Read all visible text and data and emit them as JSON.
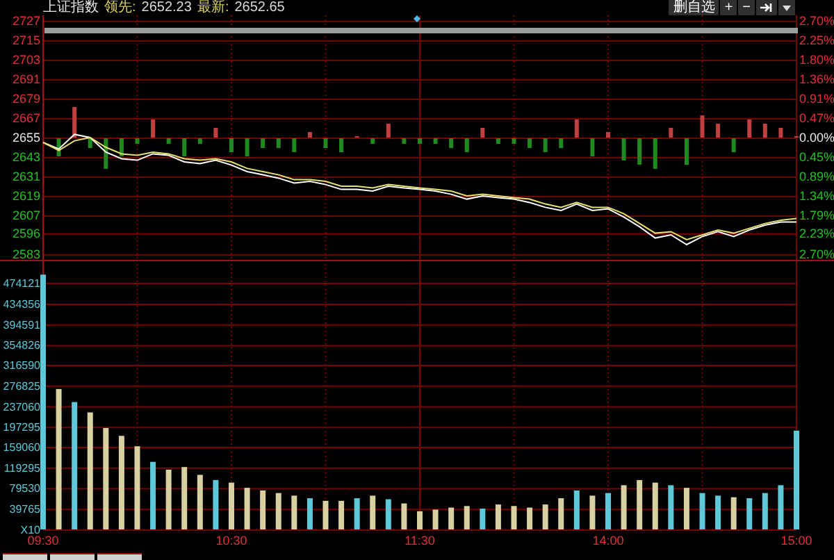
{
  "header": {
    "title": "上证指数",
    "lead_label": "领先:",
    "lead_value": "2652.23",
    "last_label": "最新:",
    "last_value": "2652.65"
  },
  "toolbar": [
    {
      "kind": "text",
      "label": "删自选"
    },
    {
      "kind": "text",
      "label": "+"
    },
    {
      "kind": "text",
      "label": "−"
    },
    {
      "kind": "jump"
    },
    {
      "kind": "dropdown"
    }
  ],
  "percent_axis": [
    {
      "text": "2.70%",
      "kind": "up"
    },
    {
      "text": "2.25%",
      "kind": "up"
    },
    {
      "text": "1.80%",
      "kind": "up"
    },
    {
      "text": "1.36%",
      "kind": "up"
    },
    {
      "text": "0.91%",
      "kind": "up"
    },
    {
      "text": "0.47%",
      "kind": "up"
    },
    {
      "text": "0.00%",
      "kind": "flat"
    },
    {
      "text": "0.45%",
      "kind": "down"
    },
    {
      "text": "0.89%",
      "kind": "down"
    },
    {
      "text": "1.34%",
      "kind": "down"
    },
    {
      "text": "1.79%",
      "kind": "down"
    },
    {
      "text": "2.23%",
      "kind": "down"
    },
    {
      "text": "2.70%",
      "kind": "down"
    }
  ],
  "price_chart": {
    "chart_data": {
      "type": "line",
      "grid": true,
      "ylim": [
        2583,
        2727
      ],
      "yticks": [
        {
          "value": 2727,
          "label": "2727"
        },
        {
          "value": 2715,
          "label": "2715"
        },
        {
          "value": 2703,
          "label": "2703"
        },
        {
          "value": 2691,
          "label": "2691"
        },
        {
          "value": 2679,
          "label": "2679"
        },
        {
          "value": 2667,
          "label": "2667"
        },
        {
          "value": 2655,
          "label": "2655"
        },
        {
          "value": 2643,
          "label": "2643"
        },
        {
          "value": 2631,
          "label": "2631"
        },
        {
          "value": 2619,
          "label": "2619"
        },
        {
          "value": 2607,
          "label": "2607"
        },
        {
          "value": 2596,
          "label": "2596"
        },
        {
          "value": 2583,
          "label": "2583"
        }
      ],
      "series": [
        {
          "color": "#ffffff",
          "values": [
            2652,
            2648,
            2657,
            2655,
            2646,
            2642,
            2641,
            2645,
            2644,
            2640,
            2639,
            2641,
            2638,
            2634,
            2632,
            2630,
            2627,
            2628,
            2626,
            2623,
            2623,
            2622,
            2625,
            2624,
            2623,
            2622,
            2620,
            2617,
            2619,
            2618,
            2617,
            2615,
            2612,
            2610,
            2614,
            2610,
            2611,
            2606,
            2600,
            2593,
            2595,
            2589,
            2594,
            2597,
            2594,
            2598,
            2601,
            2603,
            2603
          ]
        },
        {
          "color": "#e8e070",
          "values": [
            2652,
            2647,
            2653,
            2655,
            2649,
            2645,
            2644,
            2646,
            2645,
            2642,
            2641,
            2642,
            2640,
            2636,
            2634,
            2632,
            2629,
            2629,
            2628,
            2625,
            2625,
            2624,
            2626,
            2625,
            2624,
            2623,
            2622,
            2619,
            2620,
            2619,
            2618,
            2617,
            2614,
            2612,
            2615,
            2612,
            2612,
            2608,
            2602,
            2596,
            2597,
            2592,
            2595,
            2598,
            2596,
            2599,
            2602,
            2604,
            2605
          ]
        }
      ]
    }
  },
  "volume_chart": {
    "chart_data": {
      "type": "bar",
      "grid": true,
      "ylim": [
        0,
        497000
      ],
      "yticks": [
        {
          "value": 474121,
          "label": "474121"
        },
        {
          "value": 434356,
          "label": "434356"
        },
        {
          "value": 394591,
          "label": "394591"
        },
        {
          "value": 354826,
          "label": "354826"
        },
        {
          "value": 316590,
          "label": "316590"
        },
        {
          "value": 276825,
          "label": "276825"
        },
        {
          "value": 237060,
          "label": "237060"
        },
        {
          "value": 197295,
          "label": "197295"
        },
        {
          "value": 159060,
          "label": "159060"
        },
        {
          "value": 119295,
          "label": "119295"
        },
        {
          "value": 79530,
          "label": "79530"
        },
        {
          "value": 39765,
          "label": "39765"
        },
        {
          "value": 0,
          "label": "X10"
        }
      ],
      "categories": [
        "09:30",
        null,
        null,
        null,
        null,
        null,
        null,
        null,
        null,
        null,
        null,
        null,
        "10:30",
        null,
        null,
        null,
        null,
        null,
        null,
        null,
        null,
        null,
        null,
        null,
        "11:30",
        null,
        null,
        null,
        null,
        null,
        null,
        null,
        null,
        null,
        null,
        null,
        "14:00",
        null,
        null,
        null,
        null,
        null,
        null,
        null,
        null,
        null,
        null,
        null,
        "15:00"
      ],
      "series": [
        {
          "color": "#5fc8d8",
          "values": [
            490000,
            null,
            245000,
            null,
            null,
            null,
            null,
            130000,
            null,
            null,
            null,
            95000,
            null,
            null,
            null,
            null,
            null,
            60000,
            null,
            null,
            60000,
            null,
            58000,
            null,
            null,
            null,
            null,
            null,
            40000,
            null,
            null,
            null,
            null,
            null,
            75000,
            null,
            70000,
            null,
            null,
            null,
            85000,
            null,
            70000,
            65000,
            null,
            60000,
            70000,
            85000,
            190000
          ]
        },
        {
          "color": "#d8d0a0",
          "values": [
            null,
            270000,
            null,
            225000,
            195000,
            180000,
            160000,
            null,
            115000,
            120000,
            105000,
            null,
            90000,
            80000,
            75000,
            70000,
            65000,
            null,
            55000,
            55000,
            null,
            65000,
            null,
            50000,
            35000,
            38000,
            42000,
            45000,
            null,
            48000,
            45000,
            42000,
            48000,
            60000,
            null,
            65000,
            null,
            85000,
            95000,
            90000,
            null,
            80000,
            null,
            null,
            62000,
            null,
            null,
            null,
            null
          ]
        }
      ],
      "stacked": true
    }
  }
}
